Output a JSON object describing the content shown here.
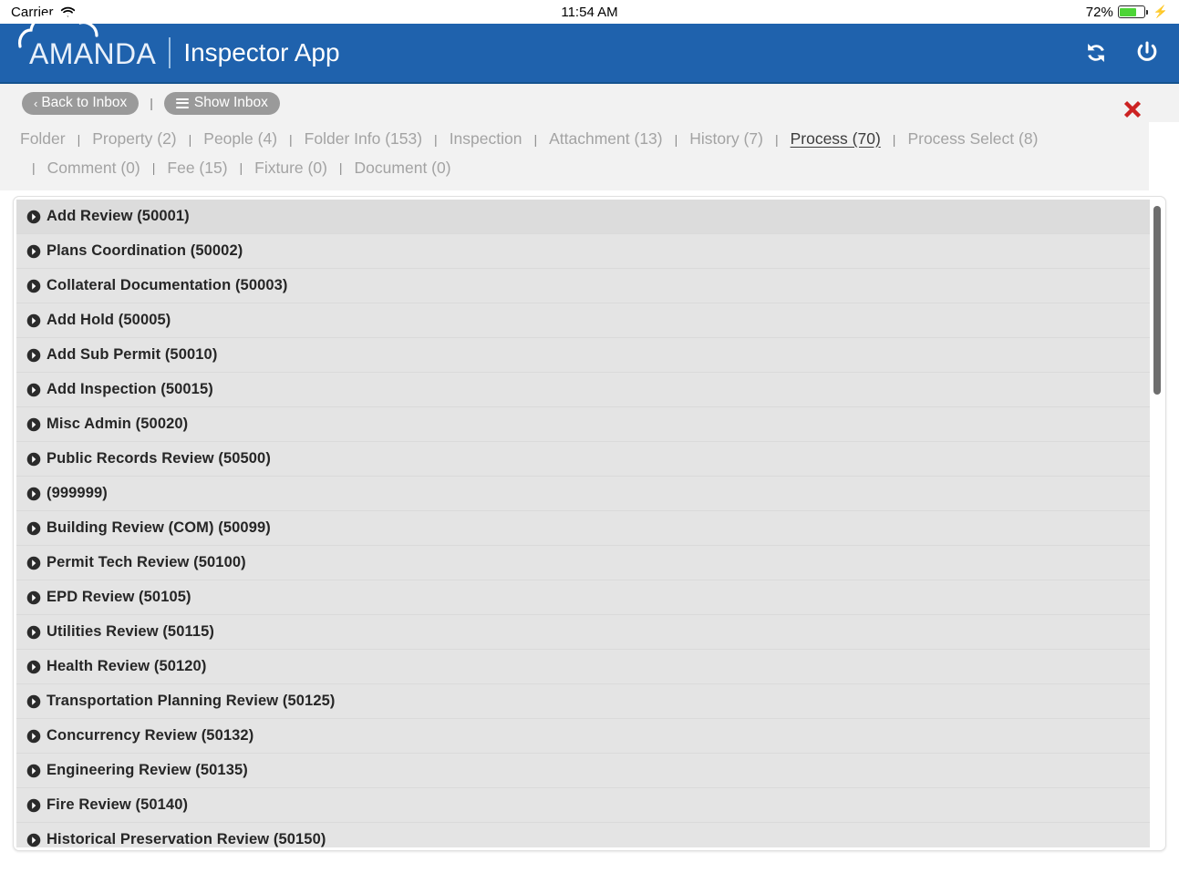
{
  "status_bar": {
    "carrier": "Carrier",
    "wifi_icon": "wifi-icon",
    "time": "11:54 AM",
    "battery_percent": "72%",
    "battery_level": 72,
    "charging_icon": "lightning-bolt-icon"
  },
  "header": {
    "logo_icon": "cloud-logo-icon",
    "brand": "AMANDA",
    "app_name": "Inspector App",
    "accent_color": "#1f62ad",
    "refresh_icon": "refresh-icon",
    "power_icon": "power-icon"
  },
  "toolbar": {
    "back_label": "Back to Inbox",
    "back_chevron": "chevron-left-icon",
    "separator": "|",
    "show_inbox_label": "Show Inbox",
    "show_inbox_icon": "hamburger-icon",
    "close_icon": "close-x-icon",
    "close_color": "#cc2222"
  },
  "tabs": {
    "separator": "|",
    "active": "Process (70)",
    "row1": [
      {
        "label": "Folder",
        "active": false
      },
      {
        "label": "Property (2)",
        "active": false
      },
      {
        "label": "People (4)",
        "active": false
      },
      {
        "label": "Folder Info (153)",
        "active": false
      },
      {
        "label": "Inspection",
        "active": false
      },
      {
        "label": "Attachment (13)",
        "active": false
      },
      {
        "label": "History (7)",
        "active": false
      },
      {
        "label": "Process (70)",
        "active": true
      },
      {
        "label": "Process Select (8)",
        "active": false
      }
    ],
    "row2": [
      {
        "label": "Comment (0)",
        "active": false
      },
      {
        "label": "Fee (15)",
        "active": false
      },
      {
        "label": "Fixture (0)",
        "active": false
      },
      {
        "label": "Document (0)",
        "active": false
      }
    ]
  },
  "process_list": {
    "row_icon": "circle-arrow-right-icon",
    "rows": [
      {
        "label": "Add Review (50001)",
        "highlight": true
      },
      {
        "label": "Plans Coordination (50002)",
        "highlight": false
      },
      {
        "label": "Collateral Documentation (50003)",
        "highlight": false
      },
      {
        "label": "Add Hold (50005)",
        "highlight": false
      },
      {
        "label": "Add Sub Permit (50010)",
        "highlight": false
      },
      {
        "label": "Add Inspection (50015)",
        "highlight": false
      },
      {
        "label": "Misc Admin (50020)",
        "highlight": false
      },
      {
        "label": "Public Records Review (50500)",
        "highlight": false
      },
      {
        "label": " (999999)",
        "highlight": false
      },
      {
        "label": "Building Review (COM) (50099)",
        "highlight": false
      },
      {
        "label": "Permit Tech Review (50100)",
        "highlight": false
      },
      {
        "label": "EPD Review (50105)",
        "highlight": false
      },
      {
        "label": "Utilities Review (50115)",
        "highlight": false
      },
      {
        "label": "Health Review (50120)",
        "highlight": false
      },
      {
        "label": "Transportation Planning Review (50125)",
        "highlight": false
      },
      {
        "label": "Concurrency Review (50132)",
        "highlight": false
      },
      {
        "label": "Engineering Review (50135)",
        "highlight": false
      },
      {
        "label": "Fire Review (50140)",
        "highlight": false
      },
      {
        "label": "Historical Preservation Review (50150)",
        "highlight": false
      }
    ],
    "scrollbar": {
      "thumb_top_pct": 1,
      "thumb_height_pct": 29
    }
  }
}
